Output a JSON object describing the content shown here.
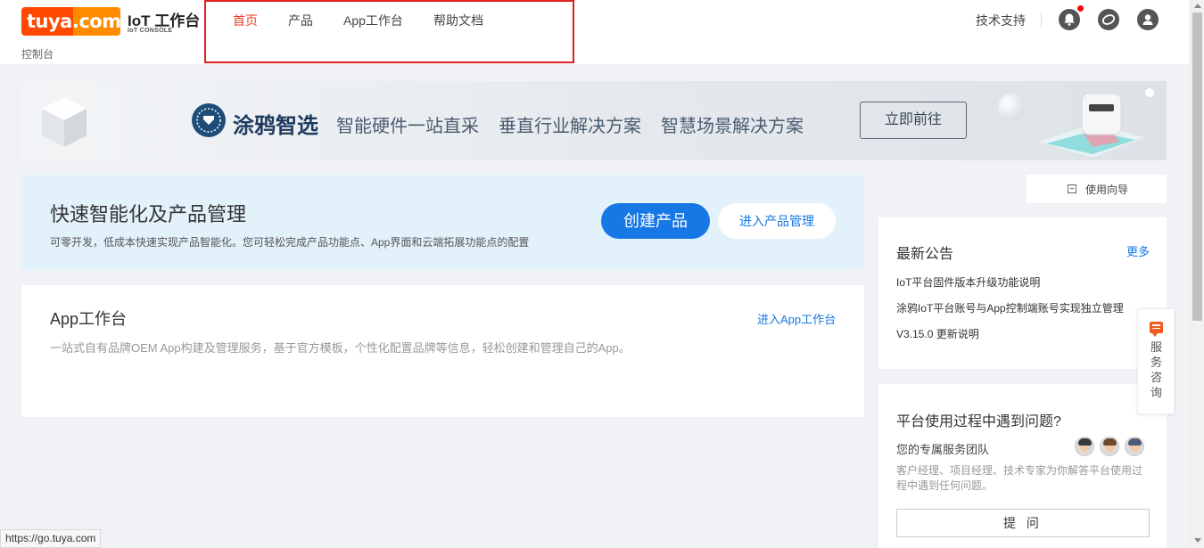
{
  "header": {
    "logo_text": "tuya.com",
    "brand_title": "IoT 工作台",
    "brand_subtitle": "IoT CONSOLE",
    "console_label": "控制台",
    "nav": [
      {
        "label": "首页",
        "active": true
      },
      {
        "label": "产品",
        "active": false
      },
      {
        "label": "App工作台",
        "active": false
      },
      {
        "label": "帮助文档",
        "active": false
      }
    ],
    "tech_support": "技术支持",
    "icons": [
      "bell-icon",
      "message-icon",
      "user-icon"
    ]
  },
  "banner": {
    "brand": "涂鸦智选",
    "taglines": [
      "智能硬件一站直采",
      "垂直行业解决方案",
      "智慧场景解决方案"
    ],
    "cta": "立即前往"
  },
  "quick": {
    "title": "快速智能化及产品管理",
    "description": "可零开发，低成本快速实现产品智能化。您可轻松完成产品功能点、App界面和云端拓展功能点的配置",
    "create_button": "创建产品",
    "manage_button": "进入产品管理"
  },
  "app_workbench": {
    "title": "App工作台",
    "link": "进入App工作台",
    "description": "一站式自有品牌OEM App构建及管理服务，基于官方模板，个性化配置品牌等信息，轻松创建和管理自己的App。"
  },
  "guide": {
    "label": "使用向导"
  },
  "notices": {
    "title": "最新公告",
    "more": "更多",
    "items": [
      "IoT平台固件版本升级功能说明",
      "涂鸦IoT平台账号与App控制端账号实现独立管理",
      "V3.15.0 更新说明"
    ]
  },
  "help": {
    "title": "平台使用过程中遇到问题?",
    "team": "您的专属服务团队",
    "description": "客户经理、项目经理、技术专家为你解答平台使用过程中遇到任何问题。",
    "ask_button": "提 问"
  },
  "service_float": {
    "label": "服务咨询"
  },
  "status_bar": {
    "url": "https://go.tuya.com"
  },
  "colors": {
    "accent": "#1677e5",
    "nav_active": "#e8402a",
    "brand_orange": "#ff4800"
  }
}
